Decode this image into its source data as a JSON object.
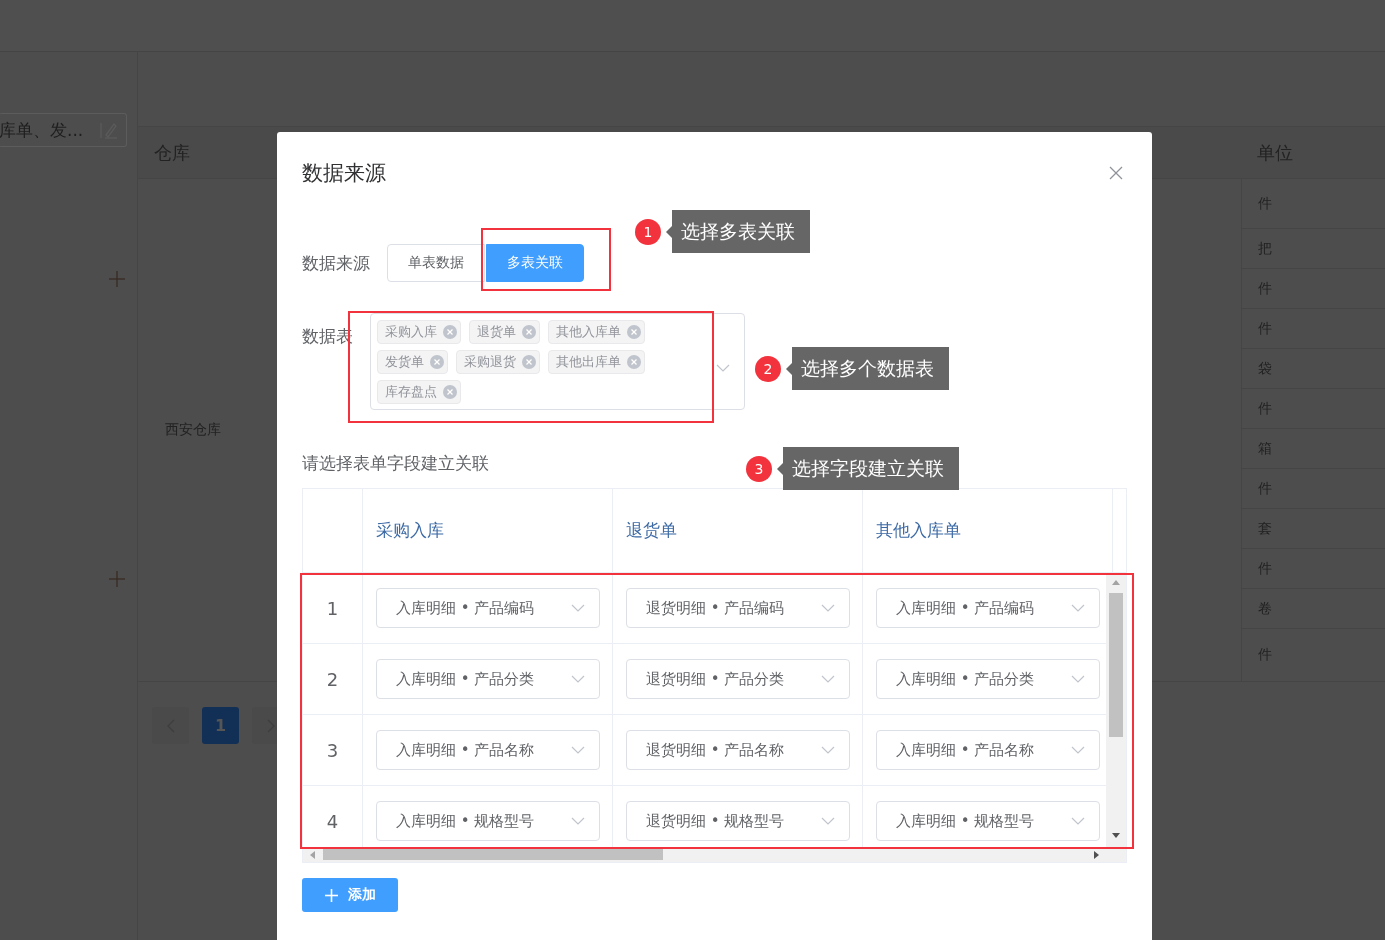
{
  "background_page": {
    "sidebar_field": {
      "value": "库单、发..."
    },
    "table": {
      "columns": [
        "仓库",
        "单位"
      ],
      "warehouse": "西安仓库",
      "units": [
        "件",
        "把",
        "件",
        "件",
        "袋",
        "件",
        "箱",
        "件",
        "套",
        "件",
        "卷",
        "件"
      ]
    },
    "pagination": {
      "pages": [
        {
          "label": "1",
          "selected": true
        }
      ]
    }
  },
  "dialog": {
    "title": "数据来源",
    "source_label": "数据来源",
    "source_options": [
      {
        "label": "单表数据",
        "selected": false
      },
      {
        "label": "多表关联",
        "selected": true
      }
    ],
    "tables_label": "数据表",
    "tables": [
      "采购入库",
      "退货单",
      "其他入库单",
      "发货单",
      "采购退货",
      "其他出库单",
      "库存盘点"
    ],
    "mapping_prompt": "请选择表单字段建立关联",
    "mapping": {
      "columns": [
        "采购入库",
        "退货单",
        "其他入库单"
      ],
      "rows": [
        {
          "index": "1",
          "fields": [
            "入库明细 • 产品编码",
            "退货明细 • 产品编码",
            "入库明细 • 产品编码"
          ]
        },
        {
          "index": "2",
          "fields": [
            "入库明细 • 产品分类",
            "退货明细 • 产品分类",
            "入库明细 • 产品分类"
          ]
        },
        {
          "index": "3",
          "fields": [
            "入库明细 • 产品名称",
            "退货明细 • 产品名称",
            "入库明细 • 产品名称"
          ]
        },
        {
          "index": "4",
          "fields": [
            "入库明细 • 规格型号",
            "退货明细 • 规格型号",
            "入库明细 • 规格型号"
          ]
        }
      ]
    },
    "add_button": "添加"
  },
  "annotations": [
    {
      "number": "1",
      "text": "选择多表关联"
    },
    {
      "number": "2",
      "text": "选择多个数据表"
    },
    {
      "number": "3",
      "text": "选择字段建立关联"
    }
  ]
}
